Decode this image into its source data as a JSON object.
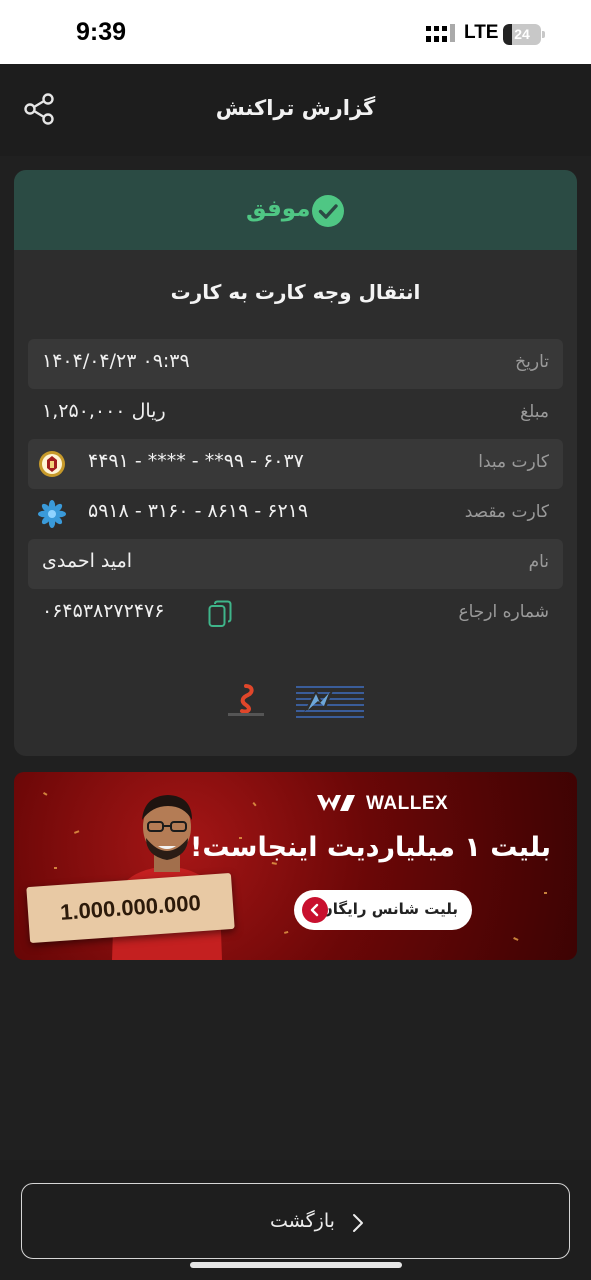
{
  "status_bar": {
    "time": "9:39",
    "network": "LTE",
    "battery_level": "24",
    "battery_fraction": 0.24,
    "signal_icon": "signal-bars-icon"
  },
  "header": {
    "title": "گزارش تراکنش",
    "share_icon": "share-icon"
  },
  "receipt": {
    "status": "موفق",
    "status_color": "#4fc784",
    "banner_color": "#2b4b44",
    "transfer_type": "انتقال وجه کارت به کارت",
    "rows": [
      {
        "label": "تاریخ",
        "value": "۱۴۰۴/۰۴/۲۳ ۰۹:۳۹"
      },
      {
        "label": "مبلغ",
        "value": "۱,۲۵۰,۰۰۰ ریال"
      },
      {
        "label": "کارت مبدا",
        "value": "۴۴۹۱ - **** - **۹۹ - ۶۰۳۷",
        "icon": "bank-melli-logo-icon"
      },
      {
        "label": "کارت مقصد",
        "value": "۵۹۱۸ - ۳۱۶۰ - ۸۶۱۹ - ۶۲۱۹",
        "icon": "saman-bank-logo-icon"
      },
      {
        "label": "نام",
        "value": "امید احمدی"
      },
      {
        "label": "شماره ارجاع",
        "value": "۰۶۴۵۳۸۲۷۲۴۷۶",
        "icon": "copy-icon"
      }
    ]
  },
  "ad": {
    "brand": "WALLEX",
    "prize_amount": "1.000.000.000",
    "headline": "بلیت ۱ میلیاردیت اینجاست!",
    "cta_label": "بلیت شانس رایگان",
    "accent_color": "#c8102e"
  },
  "footer": {
    "back_label": "بازگشت",
    "chevron_icon": "chevron-right-icon"
  }
}
